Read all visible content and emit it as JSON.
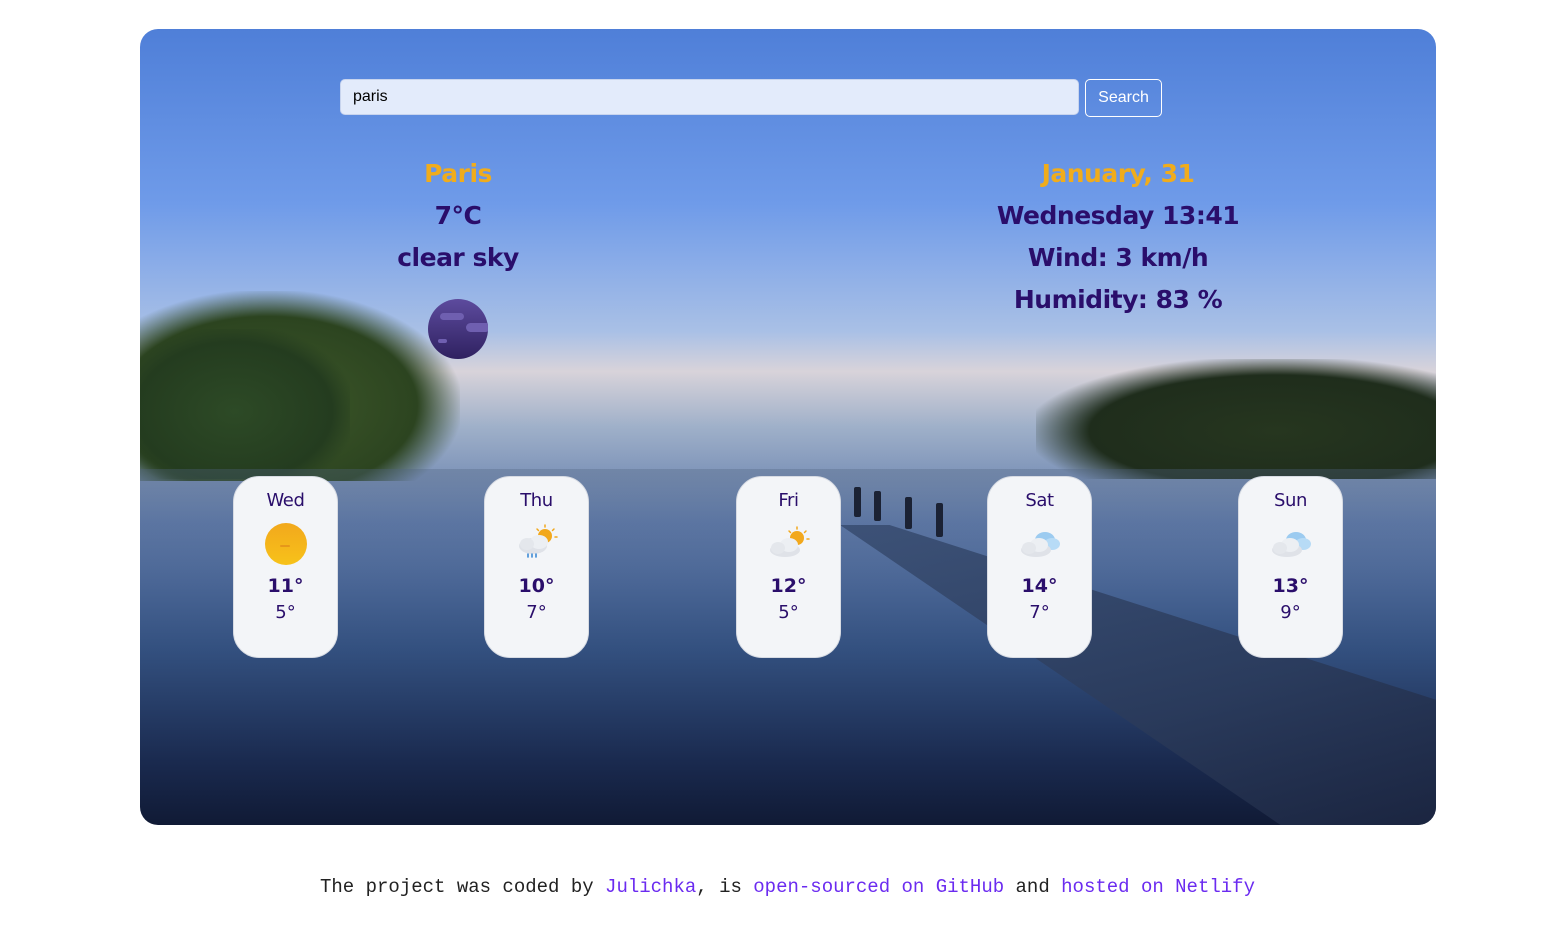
{
  "search": {
    "value": "paris",
    "button_label": "Search"
  },
  "current": {
    "city": "Paris",
    "temperature": "7°C",
    "description": "clear sky",
    "icon": "night-clear-moon-icon"
  },
  "details": {
    "date": "January, 31",
    "day_time": "Wednesday 13:41",
    "wind": "Wind: 3 km/h",
    "humidity": "Humidity: 83 %"
  },
  "forecast": [
    {
      "day": "Wed",
      "high": "11°",
      "low": "5°",
      "icon": "sun-icon"
    },
    {
      "day": "Thu",
      "high": "10°",
      "low": "7°",
      "icon": "sun-cloud-rain-icon"
    },
    {
      "day": "Fri",
      "high": "12°",
      "low": "5°",
      "icon": "sun-cloud-icon"
    },
    {
      "day": "Sat",
      "high": "14°",
      "low": "7°",
      "icon": "cloudy-icon"
    },
    {
      "day": "Sun",
      "high": "13°",
      "low": "9°",
      "icon": "cloudy-icon"
    }
  ],
  "footer": {
    "text_1": "The project was coded by ",
    "author_link": "Julichka",
    "text_2": ", is ",
    "github_link": "open-sourced on GitHub",
    "text_3": " and ",
    "netlify_link": "hosted on Netlify"
  },
  "colors": {
    "accent": "#f0ac1c",
    "primary_text": "#2a0e6b",
    "link": "#6b2bf0"
  }
}
